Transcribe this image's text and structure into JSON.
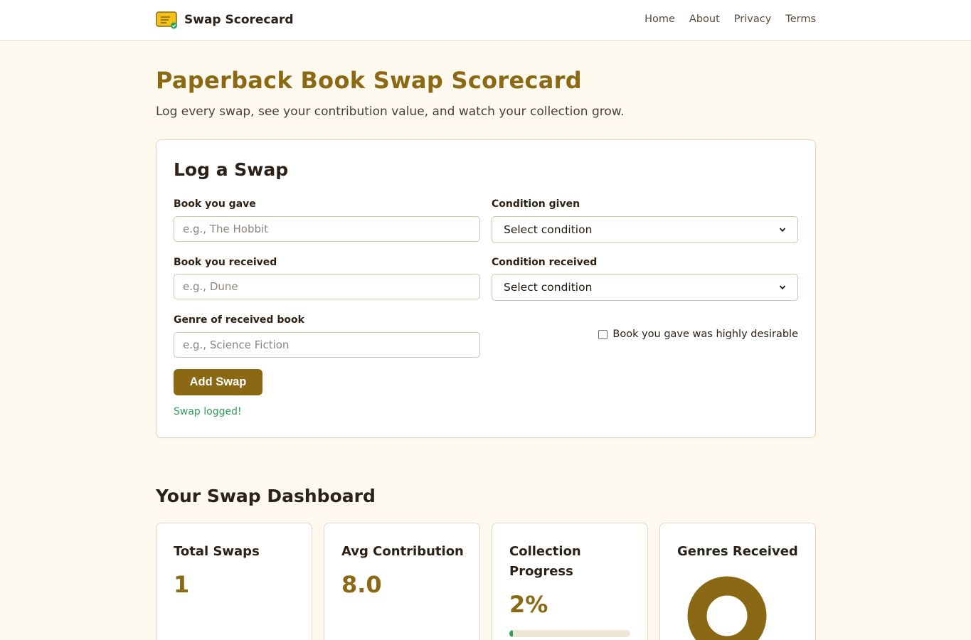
{
  "header": {
    "brand": "Swap Scorecard",
    "brand_icon": "ticket-check-icon",
    "nav": [
      "Home",
      "About",
      "Privacy",
      "Terms"
    ]
  },
  "hero": {
    "title": "Paperback Book Swap Scorecard",
    "subtitle": "Log every swap, see your contribution value, and watch your collection grow."
  },
  "form": {
    "title": "Log a Swap",
    "book_gave_label": "Book you gave",
    "book_gave_placeholder": "e.g., The Hobbit",
    "book_gave_value": "",
    "condition_given_label": "Condition given",
    "condition_given_value": "Select condition",
    "book_received_label": "Book you received",
    "book_received_placeholder": "e.g., Dune",
    "book_received_value": "",
    "condition_received_label": "Condition received",
    "condition_received_value": "Select condition",
    "genre_label": "Genre of received book",
    "genre_placeholder": "e.g., Science Fiction",
    "genre_value": "",
    "desirable_label": "Book you gave was highly desirable",
    "desirable_checked": false,
    "submit_label": "Add Swap",
    "status_message": "Swap logged!"
  },
  "dashboard": {
    "title": "Your Swap Dashboard",
    "total_swaps_label": "Total Swaps",
    "total_swaps_value": "1",
    "avg_contribution_label": "Avg Contribution",
    "avg_contribution_value": "8.0",
    "collection_progress_label": "Collection Progress",
    "collection_progress_value": "2%",
    "collection_progress_fraction": 0.02,
    "genres_label": "Genres Received",
    "genres_color": "#8b6914"
  },
  "colors": {
    "accent": "#8b6914",
    "success": "#2e9e5a",
    "background": "#fdf9ef"
  }
}
